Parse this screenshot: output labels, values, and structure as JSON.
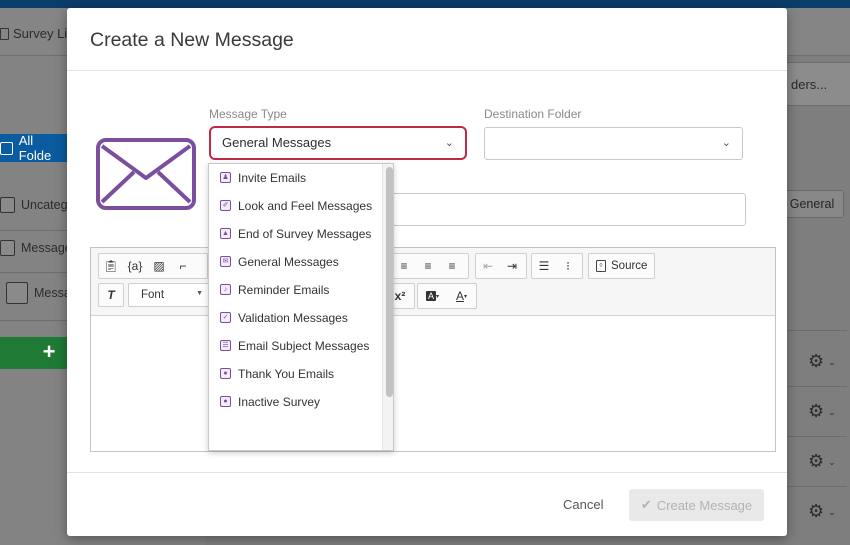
{
  "background": {
    "library_label": "Survey Libr",
    "folders_button": "ders...",
    "all_folders": "All Folde",
    "items": [
      "Uncateg",
      "Message",
      "Messa"
    ],
    "add_symbol": "+",
    "general_button": "General",
    "gear_icon": "gear-icon"
  },
  "modal": {
    "title": "Create a New Message",
    "message_type_label": "Message Type",
    "message_type_value": "General Messages",
    "destination_label": "Destination Folder",
    "destination_value": "",
    "name_value": "",
    "dropdown_options": [
      {
        "label": "Invite Emails",
        "icon": "invite-icon"
      },
      {
        "label": "Look and Feel Messages",
        "icon": "look-feel-icon"
      },
      {
        "label": "End of Survey Messages",
        "icon": "end-survey-icon"
      },
      {
        "label": "General Messages",
        "icon": "envelope-icon"
      },
      {
        "label": "Reminder Emails",
        "icon": "bell-icon"
      },
      {
        "label": "Validation Messages",
        "icon": "check-icon"
      },
      {
        "label": "Email Subject Messages",
        "icon": "subject-icon"
      },
      {
        "label": "Thank You Emails",
        "icon": "thank-you-icon"
      },
      {
        "label": "Inactive Survey",
        "icon": "inactive-icon"
      }
    ],
    "toolbar": {
      "font_label": "Font",
      "source_label": "Source",
      "piped_text": "{a}",
      "superscript": "x²"
    },
    "cancel_label": "Cancel",
    "create_label": "Create Message",
    "accent_color": "#7b4f9e",
    "highlight_color": "#c12a44"
  }
}
